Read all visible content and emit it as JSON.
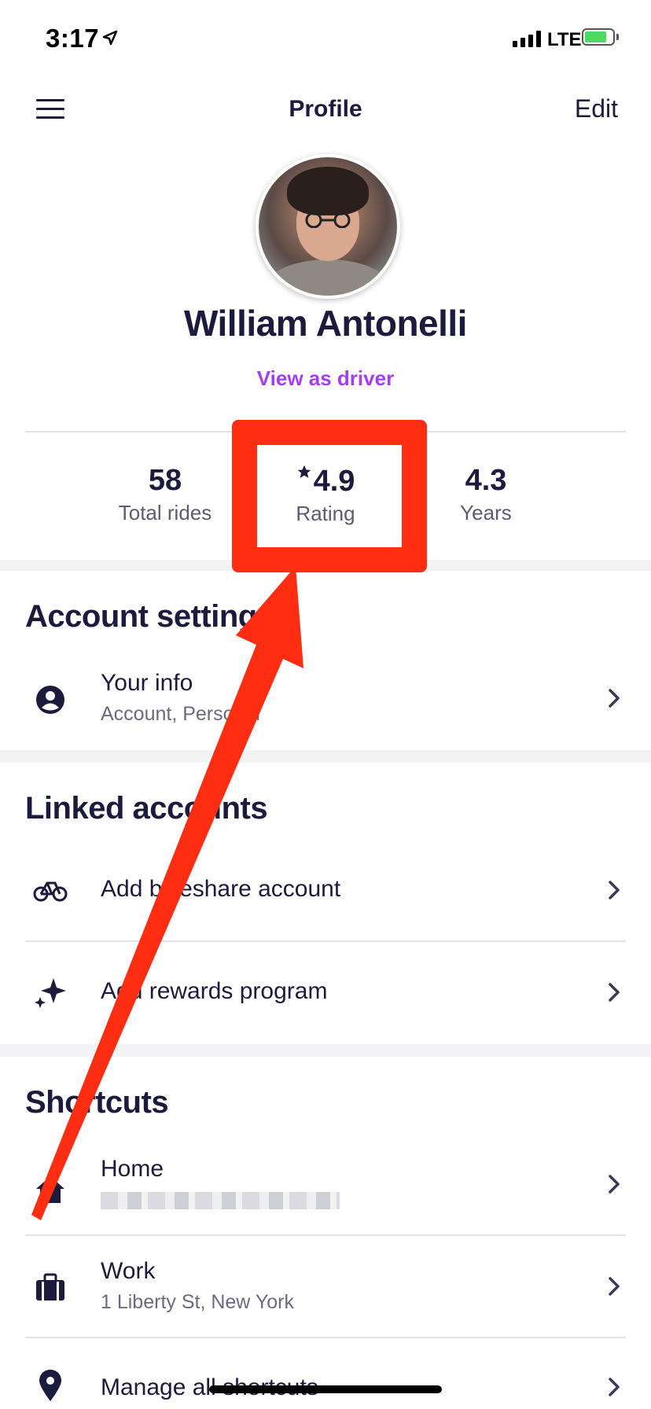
{
  "status_bar": {
    "time": "3:17",
    "network": "LTE"
  },
  "header": {
    "title": "Profile",
    "edit_label": "Edit"
  },
  "profile": {
    "name": "William Antonelli",
    "view_as_driver": "View as driver"
  },
  "stats": [
    {
      "value": "58",
      "label": "Total rides"
    },
    {
      "value": "4.9",
      "label": "Rating",
      "icon": "star-icon"
    },
    {
      "value": "4.3",
      "label": "Years"
    }
  ],
  "account_settings": {
    "title": "Account settings",
    "items": [
      {
        "title": "Your info",
        "subtitle": "Account, Personal",
        "icon": "user-circle-icon"
      }
    ]
  },
  "linked_accounts": {
    "title": "Linked accounts",
    "items": [
      {
        "title": "Add bikeshare account",
        "icon": "bicycle-icon"
      },
      {
        "title": "Add rewards program",
        "icon": "sparkle-icon"
      }
    ]
  },
  "shortcuts": {
    "title": "Shortcuts",
    "items": [
      {
        "title": "Home",
        "subtitle": "",
        "icon": "home-icon"
      },
      {
        "title": "Work",
        "subtitle": "1 Liberty St, New York",
        "icon": "briefcase-icon"
      },
      {
        "title": "Manage all shortcuts",
        "icon": "location-pin-icon"
      }
    ]
  },
  "colors": {
    "accent": "#a63df0",
    "text": "#1c1b3d",
    "annotation": "#ff2d12",
    "band": "#f3f3f6"
  }
}
